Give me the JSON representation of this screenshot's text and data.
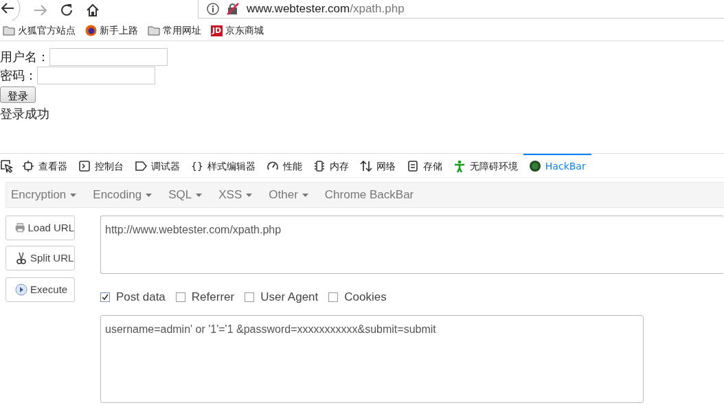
{
  "browser": {
    "url_host": "www.webtester.com",
    "url_path": "/xpath.php"
  },
  "bookmarks": [
    {
      "label": "火狐官方站点",
      "kind": "folder"
    },
    {
      "label": "新手上路",
      "kind": "firefox"
    },
    {
      "label": "常用网址",
      "kind": "folder"
    },
    {
      "label": "京东商城",
      "kind": "jd",
      "logo": "JD"
    }
  ],
  "page": {
    "fields": [
      {
        "label": "用户名："
      },
      {
        "label": "密码："
      }
    ],
    "button": "登录",
    "message": "登录成功"
  },
  "devtools_tabs": [
    {
      "label": "查看器",
      "kind": "inspector",
      "selected": false
    },
    {
      "label": "控制台",
      "kind": "console",
      "selected": false
    },
    {
      "label": "调试器",
      "kind": "debugger",
      "selected": false
    },
    {
      "label": "样式编辑器",
      "kind": "style",
      "icon": "{}",
      "selected": false
    },
    {
      "label": "性能",
      "kind": "performance",
      "selected": false
    },
    {
      "label": "内存",
      "kind": "memory",
      "selected": false
    },
    {
      "label": "网络",
      "kind": "network",
      "selected": false
    },
    {
      "label": "存储",
      "kind": "storage",
      "selected": false
    },
    {
      "label": "无障碍环境",
      "kind": "accessibility",
      "selected": false
    },
    {
      "label": "HackBar",
      "kind": "hackbar",
      "selected": true
    }
  ],
  "hackbar": {
    "menu": [
      {
        "label": "Encryption",
        "dropdown": true
      },
      {
        "label": "Encoding",
        "dropdown": true
      },
      {
        "label": "SQL",
        "dropdown": true
      },
      {
        "label": "XSS",
        "dropdown": true
      },
      {
        "label": "Other",
        "dropdown": true
      },
      {
        "label": "Chrome BackBar",
        "dropdown": false
      }
    ],
    "buttons": [
      {
        "label": "Load URL",
        "kind": "load"
      },
      {
        "label": "Split URL",
        "kind": "split"
      },
      {
        "label": "Execute",
        "kind": "execute"
      }
    ],
    "url": "http://www.webtester.com/xpath.php",
    "options": [
      {
        "label": "Post data",
        "checked": true
      },
      {
        "label": "Referrer",
        "checked": false
      },
      {
        "label": "User Agent",
        "checked": false
      },
      {
        "label": "Cookies",
        "checked": false
      }
    ],
    "post_data": "username=admin' or '1'='1 &password=xxxxxxxxxxx&submit=submit"
  }
}
